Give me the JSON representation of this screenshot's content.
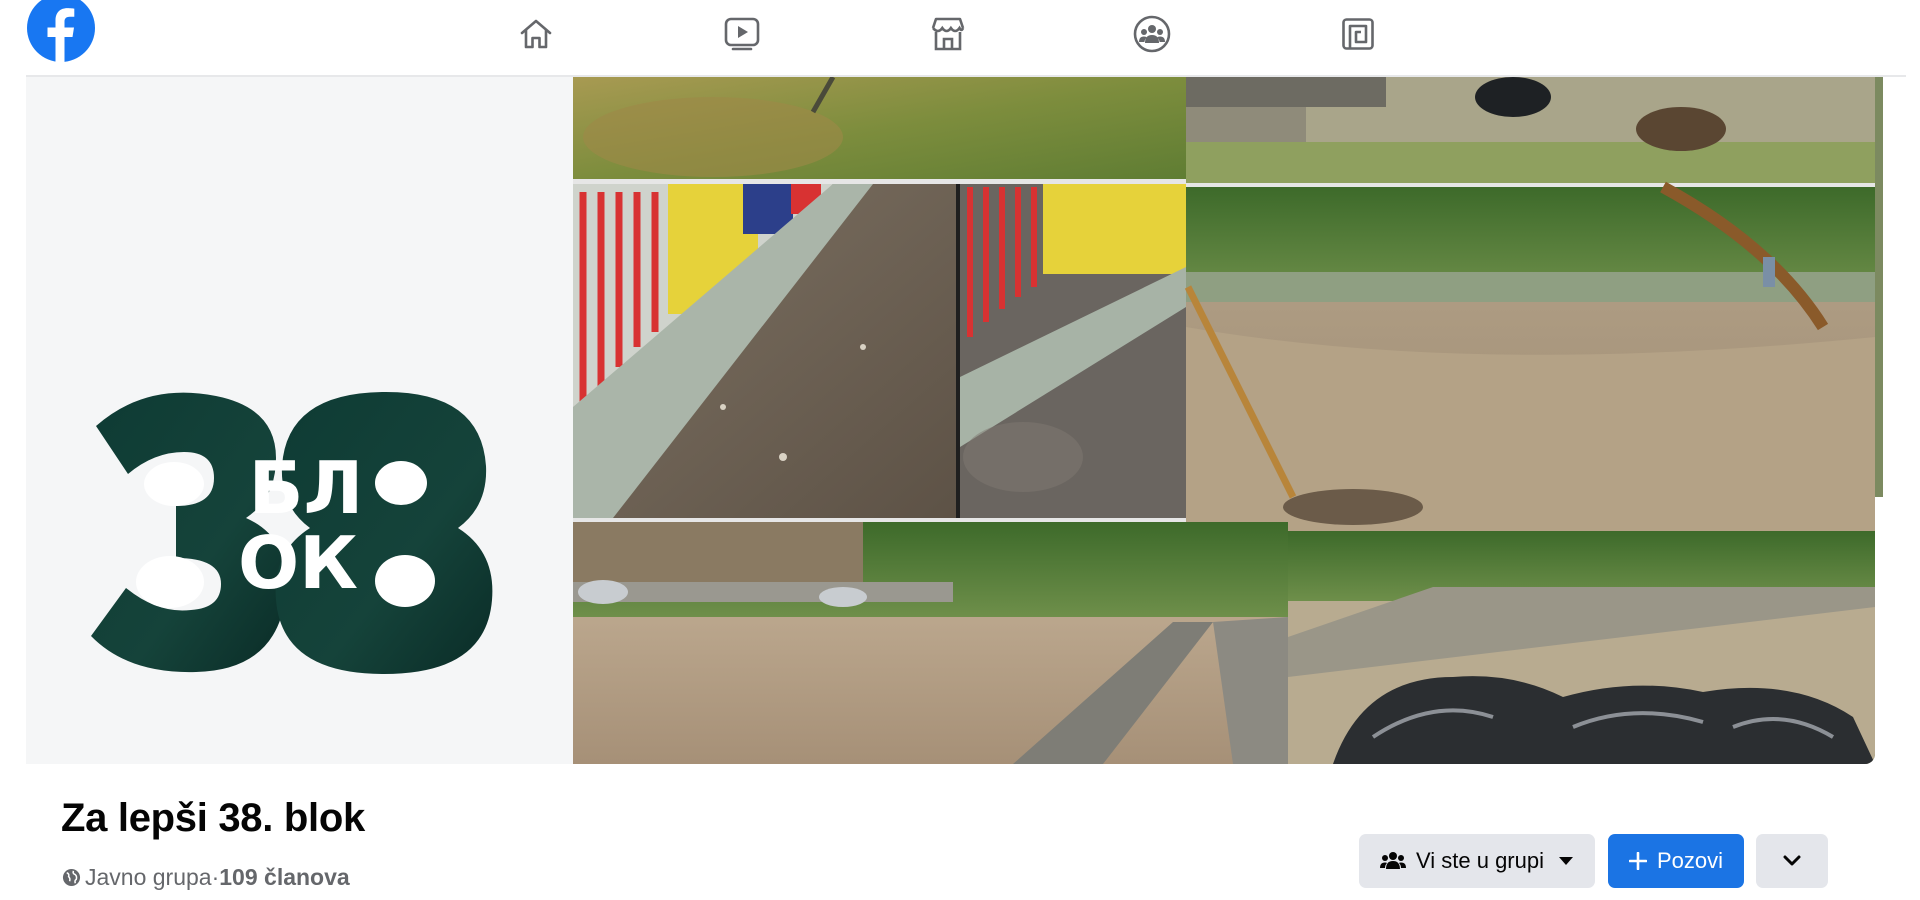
{
  "nav": {
    "logo": "facebook-logo",
    "items": [
      {
        "id": "home",
        "icon": "home-icon"
      },
      {
        "id": "watch",
        "icon": "video-icon"
      },
      {
        "id": "marketplace",
        "icon": "marketplace-icon"
      },
      {
        "id": "groups",
        "icon": "groups-icon"
      },
      {
        "id": "gaming",
        "icon": "gaming-icon"
      }
    ]
  },
  "cover": {
    "logo_text_top": "БЛ",
    "logo_text_bottom": "ОК",
    "logo_number": "38",
    "logo_color": "#0f3b35"
  },
  "group": {
    "title": "Za lepši 38. blok",
    "privacy": "Javno grupa",
    "separator": " · ",
    "members": "109 članova"
  },
  "actions": {
    "member_label": "Vi ste u grupi",
    "invite_label": "Pozovi"
  },
  "colors": {
    "brand_blue": "#1b74e4",
    "button_gray": "#e4e6eb",
    "text_secondary": "#65676b"
  }
}
